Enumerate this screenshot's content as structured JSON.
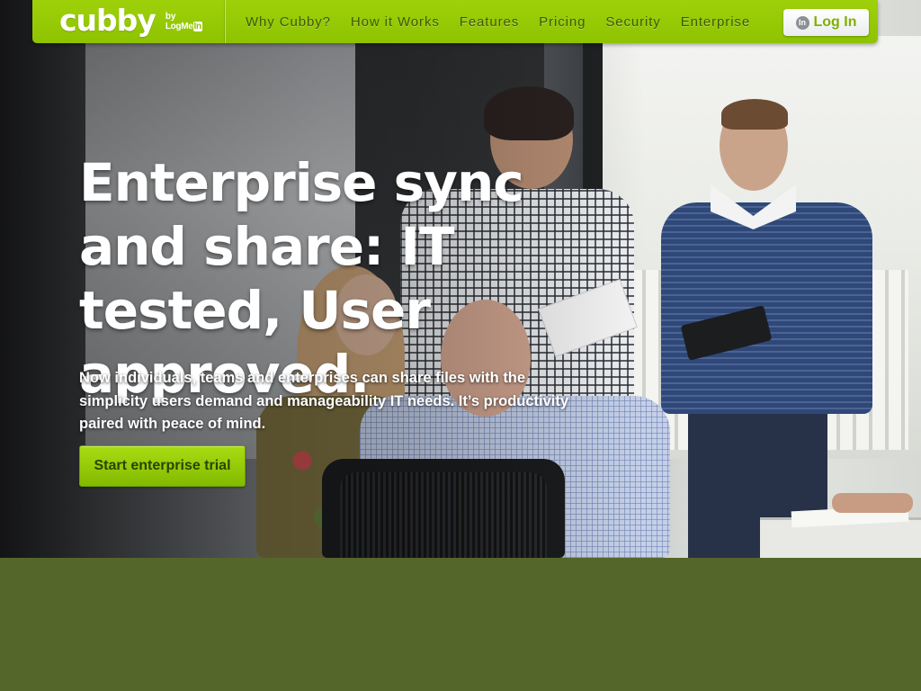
{
  "brand": {
    "name": "cubby",
    "by": "by",
    "partner": "LogMe",
    "partner_suffix": "In",
    "color": "#8ec300"
  },
  "nav": {
    "links": [
      {
        "label": "Why Cubby?"
      },
      {
        "label": "How it Works"
      },
      {
        "label": "Features"
      },
      {
        "label": "Pricing"
      },
      {
        "label": "Security"
      },
      {
        "label": "Enterprise"
      }
    ],
    "login": {
      "label": "Log In",
      "icon": "logmein-icon",
      "icon_text": "In"
    }
  },
  "hero": {
    "headline": "Enterprise sync and share: IT tested, User approved.",
    "subtext": "Now individuals, teams and enterprises can share files with the simplicity users demand and manageability IT needs. It’s productivity paired with peace of mind.",
    "cta_label": "Start enterprise trial",
    "image": "office-meeting-photo"
  },
  "colors": {
    "nav_green": "#9fd10a",
    "cta_green": "#8ec300",
    "footer_olive": "#55662a"
  }
}
